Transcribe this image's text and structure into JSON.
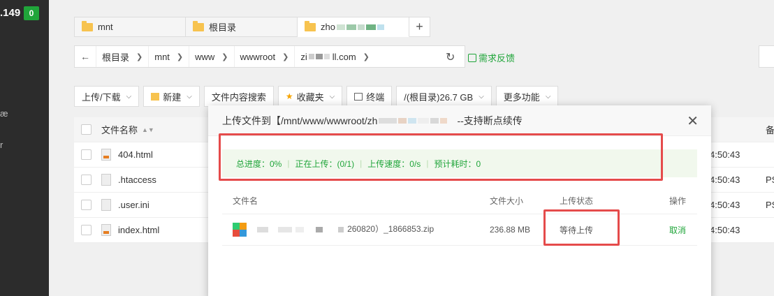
{
  "sidebar": {
    "ip_fragment": ".149",
    "badge": "0",
    "item_a": "æ",
    "item_b": "r"
  },
  "tabs": [
    {
      "label": "mnt"
    },
    {
      "label": "根目录"
    },
    {
      "label": "zho"
    }
  ],
  "tab_add": "+",
  "path": {
    "back": "←",
    "crumbs": [
      "根目录",
      "mnt",
      "www",
      "wwwroot",
      "zi",
      "ll.com"
    ],
    "refresh": "↻",
    "feedback": "需求反馈"
  },
  "toolbar": {
    "upload": "上传/下载",
    "new": "新建",
    "search_content": "文件内容搜索",
    "favorites": "收藏夹",
    "terminal": "终端",
    "disk": "/(根目录)26.7 GB",
    "more": "更多功能"
  },
  "files": {
    "header_name": "文件名称",
    "header_extra": "备",
    "rows": [
      {
        "name": "404.html",
        "time": "4:50:43",
        "extra": ""
      },
      {
        "name": ".htaccess",
        "time": "4:50:43",
        "extra": "PS"
      },
      {
        "name": ".user.ini",
        "time": "4:50:43",
        "extra": "PS"
      },
      {
        "name": "index.html",
        "time": "4:50:43",
        "extra": ""
      }
    ]
  },
  "modal": {
    "title": "上传文件到【/mnt/www/wwwroot/zh",
    "title_suffix": "--支持断点续传",
    "close": "✕",
    "progress": {
      "total": "总进度：0%",
      "uploading": "正在上传：(0/1)",
      "speed": "上传速度：0/s",
      "eta": "预计耗时：0"
    },
    "table": {
      "col_name": "文件名",
      "col_size": "文件大小",
      "col_status": "上传状态",
      "col_op": "操作",
      "row": {
        "name": "260820）_1866853.zip",
        "size": "236.88 MB",
        "status": "等待上传",
        "op": "取消"
      }
    }
  },
  "colors": {
    "accent": "#20a53a",
    "highlight": "#e54b4b"
  }
}
